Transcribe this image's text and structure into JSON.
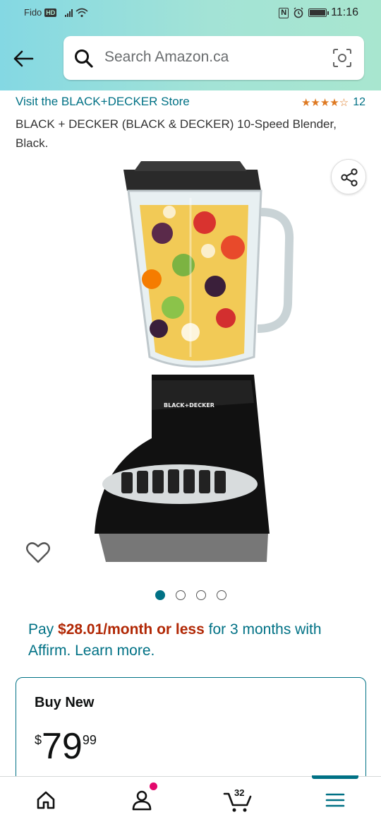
{
  "status_bar": {
    "carrier": "Fido",
    "hd": "HD",
    "nfc": "N",
    "time": "11:16"
  },
  "search": {
    "placeholder": "Search Amazon.ca"
  },
  "product": {
    "store_link": "Visit the BLACK+DECKER Store",
    "rating_stars": 3.5,
    "rating_glyphs": "★★★★☆",
    "rating_count": "12",
    "title": "BLACK + DECKER (BLACK & DECKER) 10-Speed Blender, Black.",
    "image_count": 4,
    "image_active": 1,
    "image_logo_text": "BLACK+DECKER"
  },
  "affirm": {
    "pay": "Pay ",
    "amount": "$28.01/month or less",
    "rest": " for 3 months with Affirm. Learn more."
  },
  "buy_box": {
    "heading": "Buy New",
    "currency": "$",
    "whole": "79",
    "fraction": "99"
  },
  "bottom_nav": {
    "cart_count": "32"
  },
  "colors": {
    "link": "#007185",
    "price_red": "#b12704",
    "star": "#de7921",
    "notif": "#e3086c"
  }
}
